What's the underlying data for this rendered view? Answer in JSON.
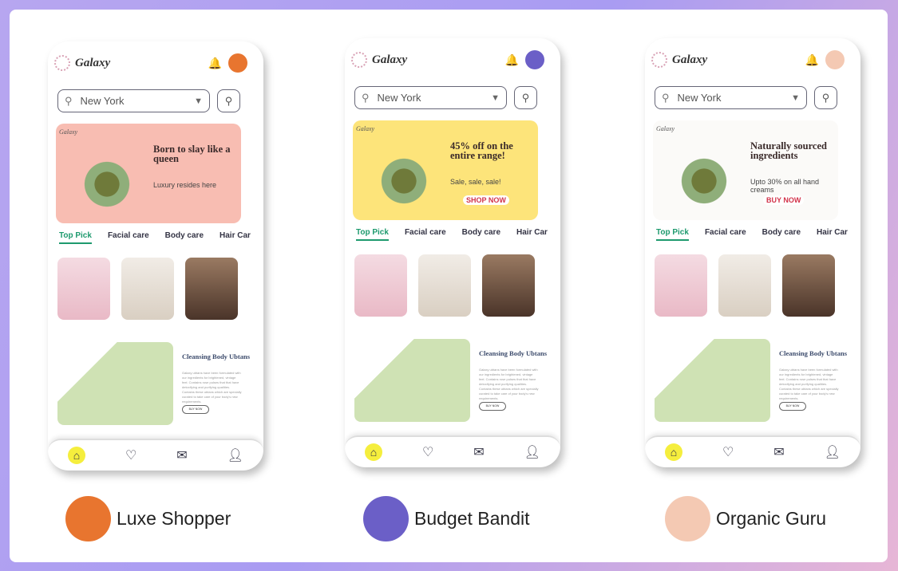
{
  "app": {
    "logo": "Galaxy",
    "location": "New York",
    "tabs": [
      "Top Pick",
      "Facial care",
      "Body care",
      "Hair Car"
    ],
    "feature": {
      "title": "Cleansing Body Ubtans",
      "body": "Galaxy ubtans have been formulated with our ingredients for brightened, vintage feel. Contains rose pulses that that have detoxifying and purifying qualities. Contains these ubtans which are specially curated to take care of your body's new requirements.",
      "button": "BUY NOW"
    },
    "icons": {
      "bell": "bell-icon",
      "search": "search-icon",
      "pin": "location-pin-icon",
      "nav": [
        "home-icon",
        "heart-icon",
        "inbox-icon",
        "user-icon"
      ]
    }
  },
  "personas": [
    {
      "name": "Luxe Shopper",
      "avatar_color": "#e8752f",
      "banner": {
        "logo": "Galaxy",
        "title": "Born to slay like a queen",
        "subtitle": "Luxury resides here",
        "cta": "",
        "bg": "#f8bdb2"
      }
    },
    {
      "name": "Budget Bandit",
      "avatar_color": "#6b5fc7",
      "banner": {
        "logo": "Galaxy",
        "title": "45% off on the entire range!",
        "subtitle": "Sale, sale, sale!",
        "cta": "SHOP NOW",
        "bg": "#fde47a"
      }
    },
    {
      "name": "Organic Guru",
      "avatar_color": "#f4c9b3",
      "banner": {
        "logo": "Galaxy",
        "title": "Naturally sourced ingredients",
        "subtitle": "Upto 30% on all hand creams",
        "cta": "BUY NOW",
        "bg": "#fbfaf8"
      }
    }
  ]
}
